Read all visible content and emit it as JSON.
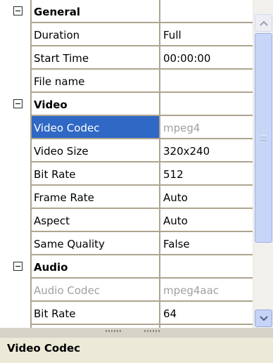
{
  "grid": {
    "categories": [
      {
        "name": "General",
        "properties": [
          {
            "name": "Duration",
            "value": "Full"
          },
          {
            "name": "Start Time",
            "value": "00:00:00"
          },
          {
            "name": "File name",
            "value": ""
          }
        ]
      },
      {
        "name": "Video",
        "properties": [
          {
            "name": "Video Codec",
            "value": "mpeg4"
          },
          {
            "name": "Video Size",
            "value": "320x240"
          },
          {
            "name": "Bit Rate",
            "value": "512"
          },
          {
            "name": "Frame Rate",
            "value": "Auto"
          },
          {
            "name": "Aspect",
            "value": "Auto"
          },
          {
            "name": "Same Quality",
            "value": "False"
          }
        ]
      },
      {
        "name": "Audio",
        "properties": [
          {
            "name": "Audio Codec",
            "value": "mpeg4aac"
          },
          {
            "name": "Bit Rate",
            "value": "64"
          }
        ]
      }
    ],
    "selected_property": "Video Codec",
    "disabled_properties": [
      "Audio Codec"
    ]
  },
  "description": {
    "title": "Video Codec"
  },
  "icons": {
    "collapse": "minus-box-icon",
    "scroll_up": "chevron-up-icon",
    "scroll_down": "chevron-down-icon",
    "thumb_grip": "grip-lines-icon"
  },
  "colors": {
    "selection": "#2f68c5",
    "gridline": "#ada590",
    "disabled_text": "#a0a0a0",
    "description_bg": "#ece9d8"
  }
}
